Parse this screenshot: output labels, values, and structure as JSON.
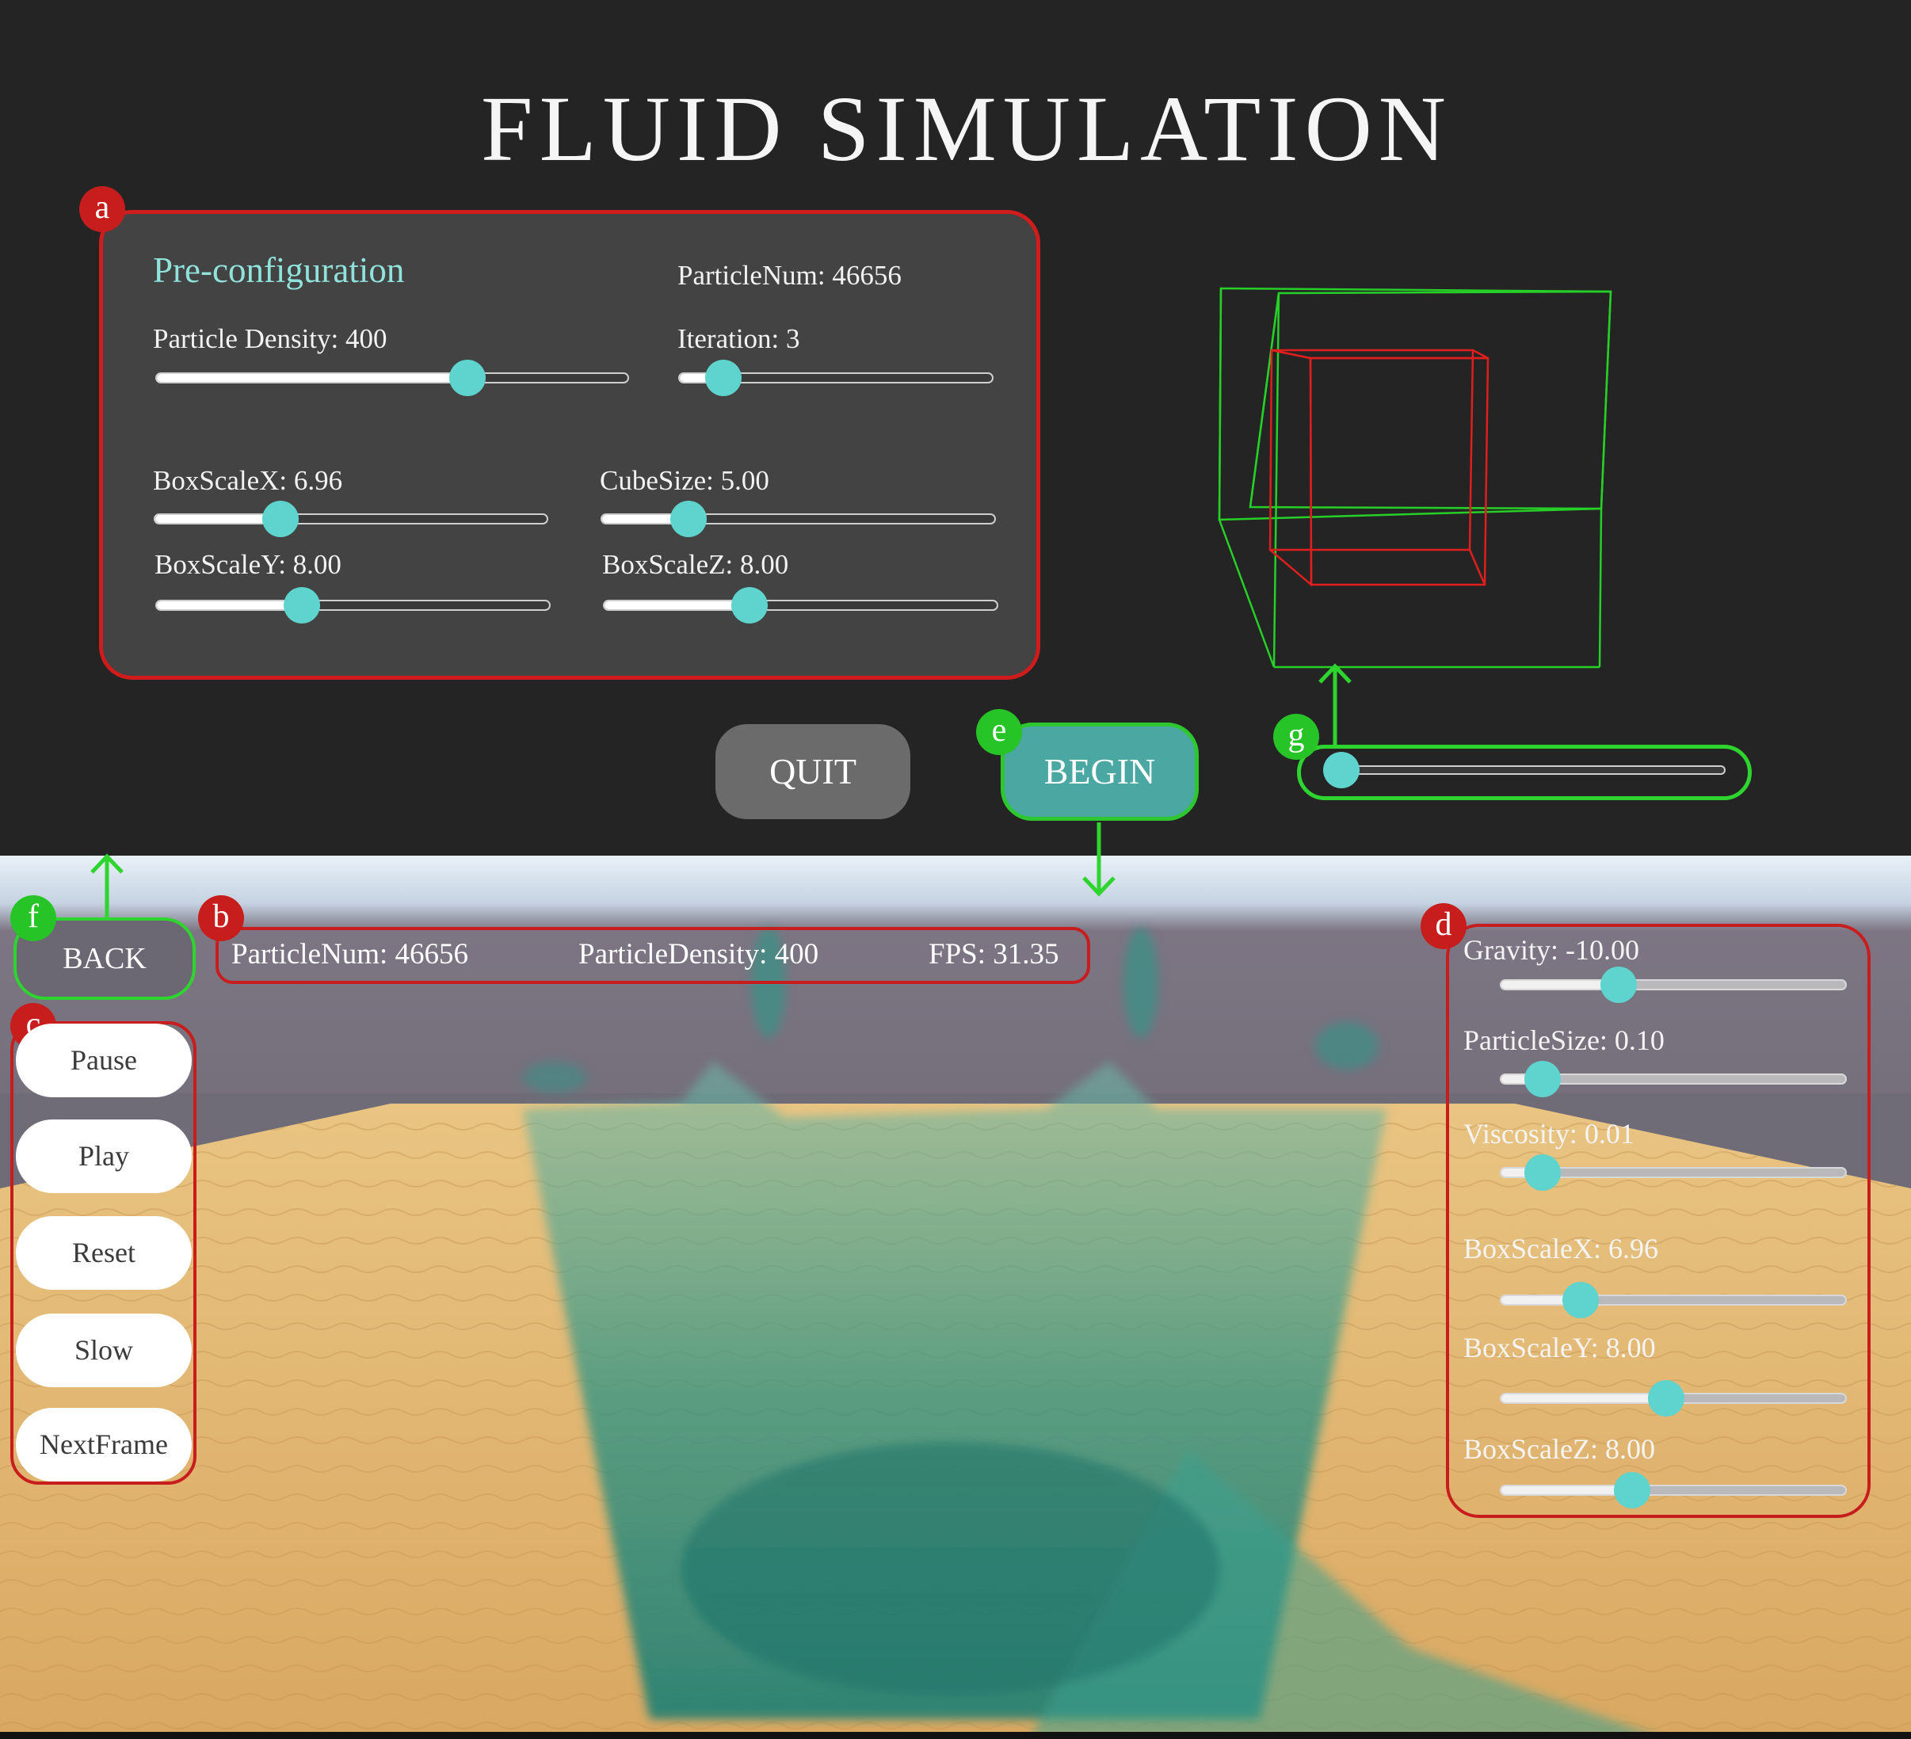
{
  "title": "FLUID SIMULATION",
  "markers": {
    "a": "a",
    "b": "b",
    "c": "c",
    "d": "d",
    "e": "e",
    "f": "f",
    "g": "g"
  },
  "preconfig": {
    "heading": "Pre-configuration",
    "particle_num": "ParticleNum: 46656",
    "sliders": {
      "density": {
        "label": "Particle Density: 400",
        "fraction": 0.66
      },
      "iteration": {
        "label": "Iteration: 3",
        "fraction": 0.14
      },
      "boxscale_x": {
        "label": "BoxScaleX: 6.96",
        "fraction": 0.32
      },
      "cube_size": {
        "label": "CubeSize: 5.00",
        "fraction": 0.22
      },
      "boxscale_y": {
        "label": "BoxScaleY: 8.00",
        "fraction": 0.37
      },
      "boxscale_z": {
        "label": "BoxScaleZ: 8.00",
        "fraction": 0.37
      }
    }
  },
  "buttons": {
    "quit": "QUIT",
    "begin": "BEGIN",
    "back": "BACK"
  },
  "view_slider": {
    "fraction": 0.03
  },
  "stats": {
    "particle_num": "ParticleNum: 46656",
    "particle_density": "ParticleDensity: 400",
    "fps": "FPS: 31.35"
  },
  "controls": [
    "Pause",
    "Play",
    "Reset",
    "Slow",
    "NextFrame"
  ],
  "runtime_sliders": {
    "gravity": {
      "label": "Gravity: -10.00",
      "fraction": 0.34
    },
    "particle_size": {
      "label": "ParticleSize: 0.10",
      "fraction": 0.12
    },
    "viscosity": {
      "label": "Viscosity: 0.01",
      "fraction": 0.12
    },
    "boxscale_x": {
      "label": "BoxScaleX: 6.96",
      "fraction": 0.23
    },
    "boxscale_y": {
      "label": "BoxScaleY: 8.00",
      "fraction": 0.48
    },
    "boxscale_z": {
      "label": "BoxScaleZ: 8.00",
      "fraction": 0.38
    }
  },
  "colors": {
    "annotation_red": "#c81d1d",
    "annotation_green": "#2fd52f",
    "slider_knob": "#5fd3cd",
    "begin_button": "#4aa7a2",
    "fluid": "#2a8c80",
    "sand": "#e2b56e"
  }
}
